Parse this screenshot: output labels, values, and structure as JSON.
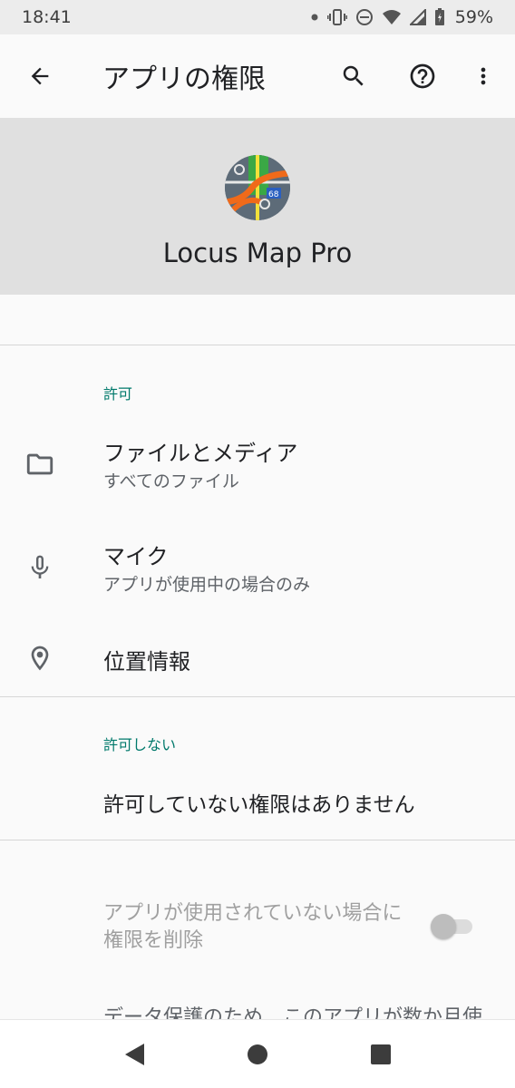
{
  "status_bar": {
    "time": "18:41",
    "battery": "59%"
  },
  "app_bar": {
    "title": "アプリの権限"
  },
  "app": {
    "name": "Locus Map Pro"
  },
  "allowed": {
    "header": "許可",
    "items": [
      {
        "title": "ファイルとメディア",
        "subtitle": "すべてのファイル",
        "icon": "folder-icon"
      },
      {
        "title": "マイク",
        "subtitle": "アプリが使用中の場合のみ",
        "icon": "microphone-icon"
      },
      {
        "title": "位置情報",
        "icon": "location-pin-icon"
      }
    ]
  },
  "denied": {
    "header": "許可しない",
    "empty_text": "許可していない権限はありません"
  },
  "auto_remove": {
    "label": "アプリが使用されていない場合に権限を削除",
    "enabled": false
  },
  "footer_text": "データ保護のため、このアプリが数か月使",
  "colors": {
    "accent": "#00796b",
    "header_bg": "#e0e0e0"
  }
}
